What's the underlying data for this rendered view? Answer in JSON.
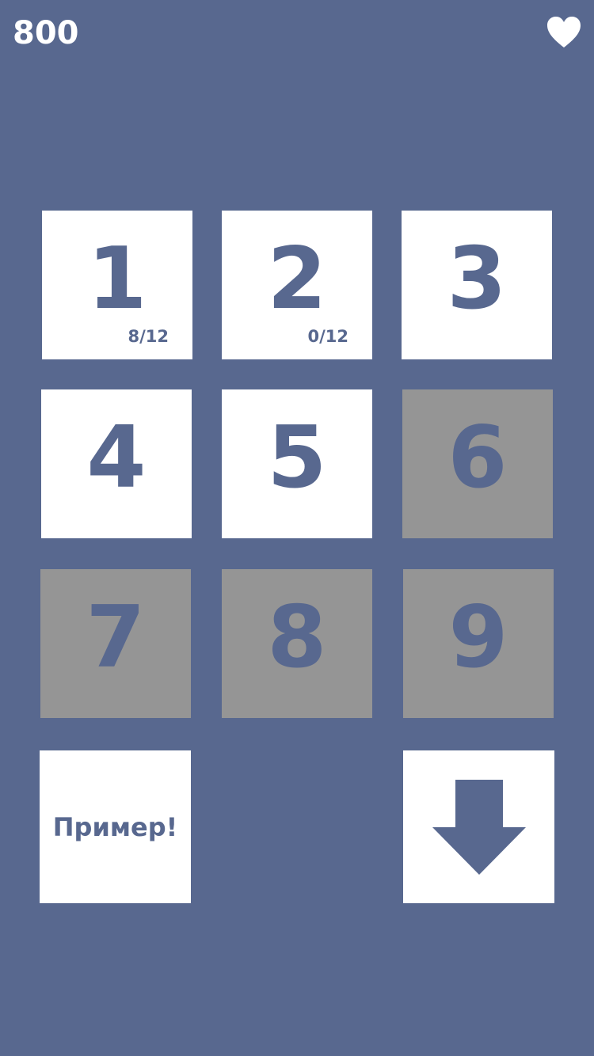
{
  "header": {
    "score": "800",
    "lives_icon": "heart-icon"
  },
  "levels": [
    {
      "number": "1",
      "progress": "8/12",
      "locked": false
    },
    {
      "number": "2",
      "progress": "0/12",
      "locked": false
    },
    {
      "number": "3",
      "progress": "",
      "locked": false
    },
    {
      "number": "4",
      "progress": "",
      "locked": false
    },
    {
      "number": "5",
      "progress": "",
      "locked": false
    },
    {
      "number": "6",
      "progress": "",
      "locked": true
    },
    {
      "number": "7",
      "progress": "",
      "locked": true
    },
    {
      "number": "8",
      "progress": "",
      "locked": true
    },
    {
      "number": "9",
      "progress": "",
      "locked": true
    }
  ],
  "actions": {
    "example_label": "Пример!",
    "down_icon": "arrow-down-icon"
  },
  "colors": {
    "background": "#58688f",
    "tile_unlocked": "#ffffff",
    "tile_locked": "#959595",
    "text_accent": "#58688f"
  }
}
